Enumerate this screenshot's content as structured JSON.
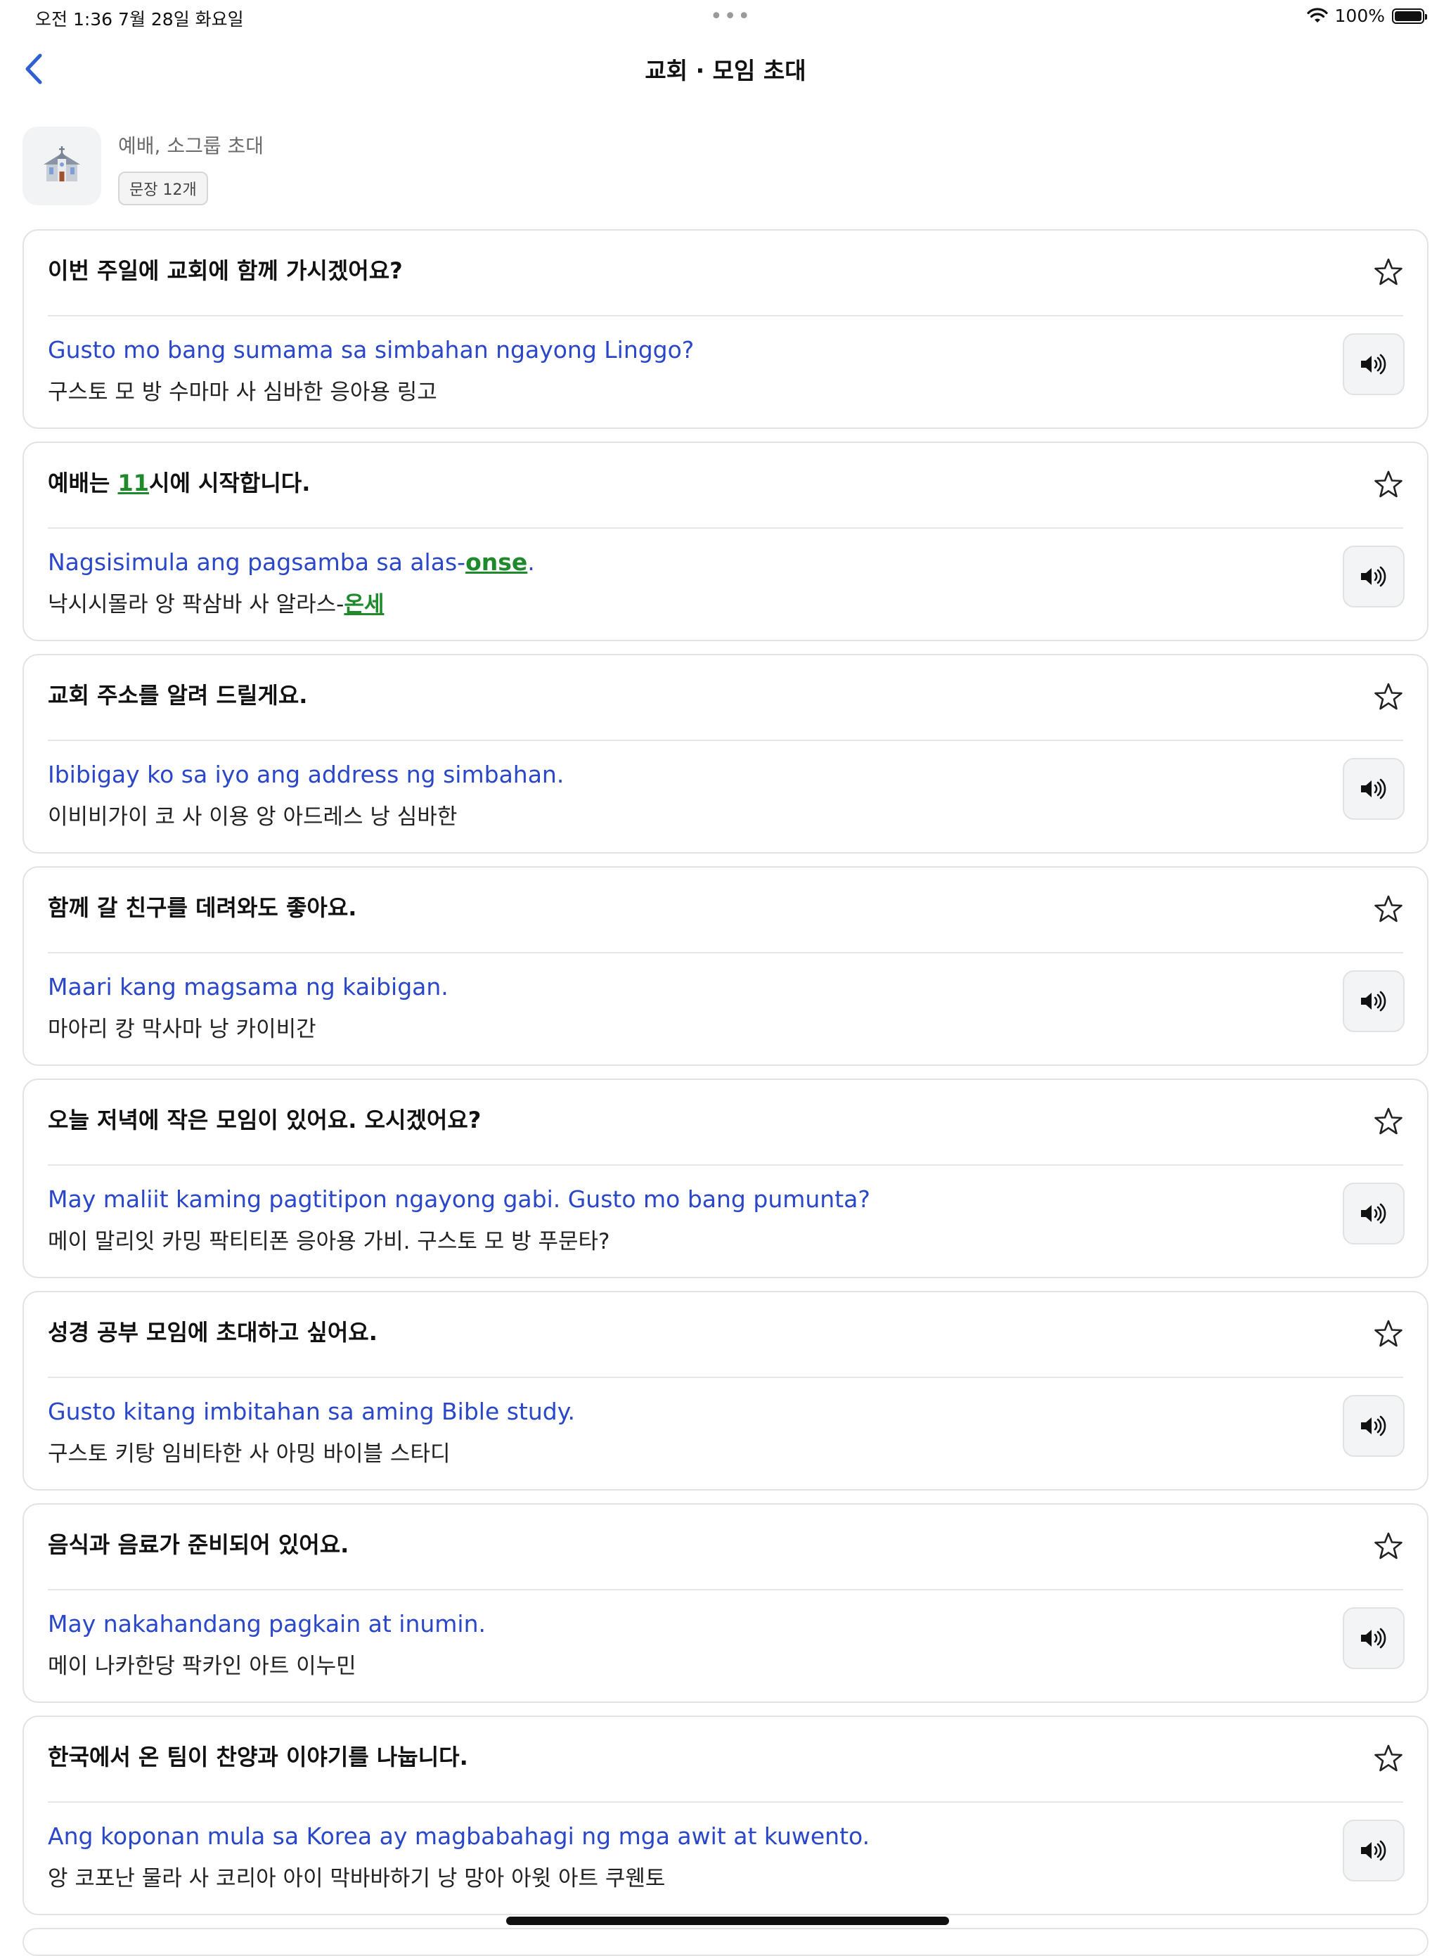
{
  "status_bar": {
    "time_date": "오전 1:36   7월 28일 화요일",
    "dots": "•••",
    "battery_text": "100%",
    "battery_level": 1.0
  },
  "nav": {
    "title": "교회 · 모임 초대"
  },
  "header": {
    "icon": "church-icon",
    "description": "예배, 소그룹 초대",
    "count_label": "문장 12개"
  },
  "colors": {
    "accent": "#2a47c9",
    "highlight": "#1f8a2c",
    "back": "#2f5fd0"
  },
  "cards": [
    {
      "ko": "이번 주일에 교회에 함께 가시겠어요?",
      "tl": "Gusto mo bang sumama sa simbahan ngayong Linggo?",
      "pron": "구스토 모 방 수마마 사 심바한 응아용 링고"
    },
    {
      "ko_before": "예배는 ",
      "ko_hl": "11",
      "ko_after": "시에 시작합니다.",
      "tl_before": "Nagsisimula ang pagsamba sa alas-",
      "tl_hl": "onse",
      "tl_after": ".",
      "pron_before": "낙시시몰라 앙 팍삼바 사 알라스-",
      "pron_hl": "온세",
      "pron_after": ""
    },
    {
      "ko": "교회 주소를 알려 드릴게요.",
      "tl": "Ibibigay ko sa iyo ang address ng simbahan.",
      "pron": "이비비가이 코 사 이용 앙 아드레스 낭 심바한"
    },
    {
      "ko": "함께 갈 친구를 데려와도 좋아요.",
      "tl": "Maari kang magsama ng kaibigan.",
      "pron": "마아리 캉 막사마 낭 카이비간"
    },
    {
      "ko": "오늘 저녁에 작은 모임이 있어요. 오시겠어요?",
      "tl": "May maliit kaming pagtitipon ngayong gabi. Gusto mo bang pumunta?",
      "pron": "메이 말리잇 카밍 팍티티폰 응아용 가비. 구스토 모 방 푸문타?"
    },
    {
      "ko": "성경 공부 모임에 초대하고 싶어요.",
      "tl": "Gusto kitang imbitahan sa aming Bible study.",
      "pron": "구스토 키탕 임비타한 사 아밍 바이블 스타디"
    },
    {
      "ko": "음식과 음료가 준비되어 있어요.",
      "tl": "May nakahandang pagkain at inumin.",
      "pron": "메이 나카한당 팍카인 아트 이누민"
    },
    {
      "ko": "한국에서 온 팀이 찬양과 이야기를 나눕니다.",
      "tl": "Ang koponan mula sa Korea ay magbabahagi ng mga awit at kuwento.",
      "pron": "앙 코포난 물라 사 코리아 아이 막바바하기 낭 망아 아윗 아트 쿠웬토"
    }
  ]
}
